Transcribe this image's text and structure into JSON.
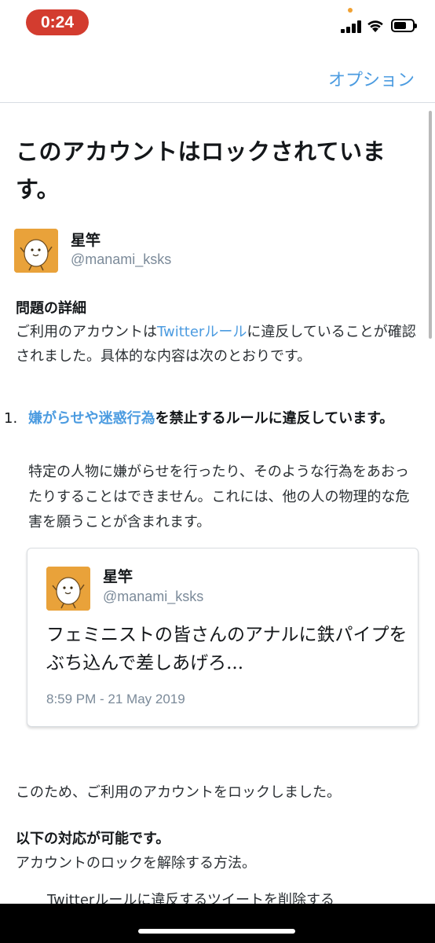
{
  "status_bar": {
    "time": "0:24"
  },
  "nav": {
    "options_label": "オプション"
  },
  "page": {
    "title": "このアカウントはロックされています。",
    "user": {
      "name": "星竿",
      "handle": "@manami_ksks"
    },
    "details_heading": "問題の詳細",
    "details_text_before": "ご利用のアカウントは",
    "details_link": "Twitterルール",
    "details_text_after": "に違反していることが確認されました。具体的な内容は次のとおりです。",
    "violation": {
      "number": "1.",
      "link": "嫌がらせや迷惑行為",
      "title_rest": "を禁止するルールに違反しています。",
      "description": "特定の人物に嫌がらせを行ったり、そのような行為をあおったりすることはできません。これには、他の人の物理的な危害を願うことが含まれます。"
    },
    "tweet": {
      "name": "星竿",
      "handle": "@manami_ksks",
      "text": "フェミニストの皆さんのアナルに鉄パイプをぶち込んで差しあげろ...",
      "time": "8:59 PM - 21 May 2019"
    },
    "locked_statement": "このため、ご利用のアカウントをロックしました。",
    "options_heading": "以下の対応が可能です。",
    "options_text": "アカウントのロックを解除する方法。",
    "cutoff_text": "Twitterルールに違反するツイートを削除する"
  },
  "colors": {
    "link": "#4b9be0",
    "time_pill": "#d33c2f",
    "avatar_bg": "#e9a23a"
  }
}
